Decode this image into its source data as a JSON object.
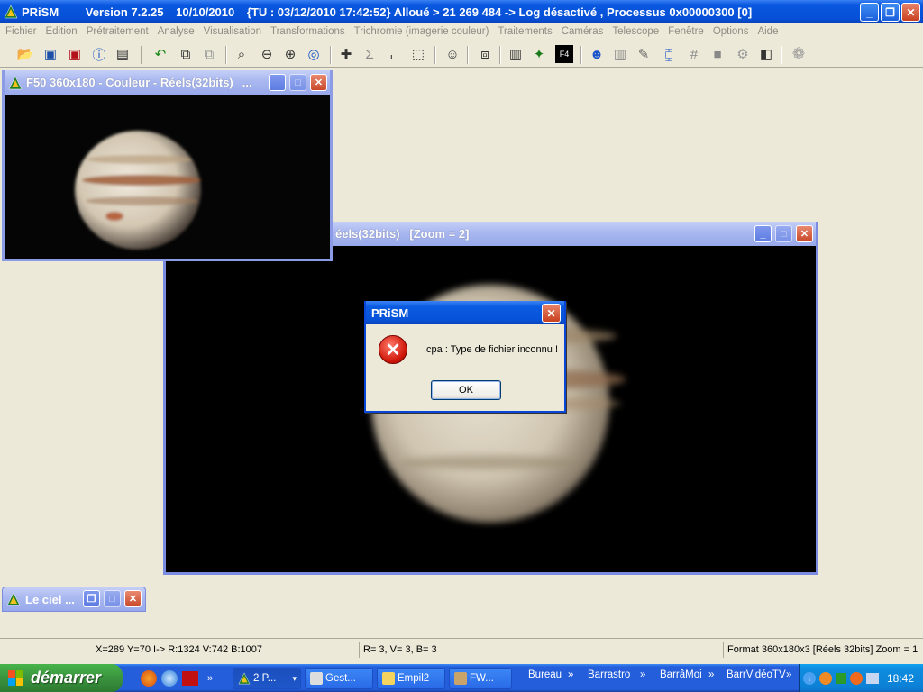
{
  "main_title": {
    "app": "PRiSM",
    "version": "Version 7.2.25",
    "date": "10/10/2010",
    "info": "{TU : 03/12/2010 17:42:52} Alloué > 21 269 484 -> Log désactivé , Processus 0x00000300 [0]"
  },
  "menu": [
    "Fichier",
    "Edition",
    "Prétraitement",
    "Analyse",
    "Visualisation",
    "Transformations",
    "Trichromie (imagerie couleur)",
    "Traitements",
    "Caméras",
    "Telescope",
    "Fenêtre",
    "Options",
    "Aide"
  ],
  "windows": {
    "f50": {
      "title": "F50 360x180 - Couleur - Réels(32bits)",
      "ellipsis": "..."
    },
    "zoom": {
      "title": "éels(32bits)   [Zoom = 2]"
    },
    "sky": {
      "title": "Le ciel ..."
    }
  },
  "dialog": {
    "title": "PRiSM",
    "message": ".cpa : Type de fichier inconnu !",
    "ok": "OK"
  },
  "status": {
    "coords": "X=289 Y=70 I-> R:1324 V:742 B:1007",
    "rvb": "R= 3, V= 3, B= 3",
    "format": "Format 360x180x3 [Réels 32bits]  Zoom = 1"
  },
  "taskbar": {
    "start": "démarrer",
    "tasks": [
      "2 P...",
      "Gest...",
      "Empil2",
      "FW..."
    ],
    "bands": [
      "Bureau",
      "Barrastro",
      "BarrâMoi",
      "BarrVidéoTV"
    ],
    "clock": "18:42"
  },
  "colors": {
    "xp_blue": "#0a58e0",
    "inactive_title": "#aab9f0",
    "start_green": "#388e3c"
  }
}
